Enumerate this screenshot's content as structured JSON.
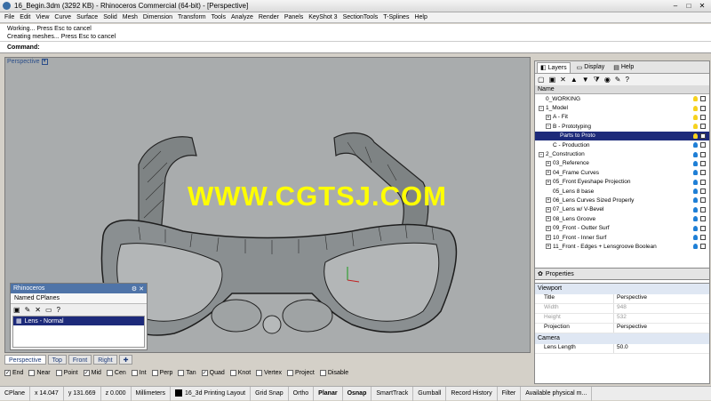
{
  "window": {
    "title": "16_Begin.3dm (3292 KB) - Rhinoceros Commercial (64-bit) - [Perspective]"
  },
  "menu": [
    "File",
    "Edit",
    "View",
    "Curve",
    "Surface",
    "Solid",
    "Mesh",
    "Dimension",
    "Transform",
    "Tools",
    "Analyze",
    "Render",
    "Panels",
    "KeyShot 3",
    "SectionTools",
    "T-Splines",
    "Help"
  ],
  "command_history": [
    "Working... Press Esc to cancel",
    "Creating meshes... Press Esc to cancel"
  ],
  "command_prompt": "Command:",
  "viewport": {
    "label": "Perspective"
  },
  "watermark": "WWW.CGTSJ.COM",
  "cplanes_panel": {
    "title": "Rhinoceros",
    "tab": "Named CPlanes",
    "items": [
      "Lens - Normal"
    ]
  },
  "viewport_tabs": [
    "Perspective",
    "Top",
    "Front",
    "Right"
  ],
  "osnaps": [
    {
      "label": "End",
      "checked": true
    },
    {
      "label": "Near",
      "checked": false
    },
    {
      "label": "Point",
      "checked": false
    },
    {
      "label": "Mid",
      "checked": true
    },
    {
      "label": "Cen",
      "checked": false
    },
    {
      "label": "Int",
      "checked": false
    },
    {
      "label": "Perp",
      "checked": false
    },
    {
      "label": "Tan",
      "checked": false
    },
    {
      "label": "Quad",
      "checked": true
    },
    {
      "label": "Knot",
      "checked": false
    },
    {
      "label": "Vertex",
      "checked": false
    },
    {
      "label": "Project",
      "checked": false
    },
    {
      "label": "Disable",
      "checked": false
    }
  ],
  "status": {
    "cplane": "CPlane",
    "x": "x 14.047",
    "y": "y 131.669",
    "z": "z 0.000",
    "units": "Millimeters",
    "layer": "16_3d Printing Layout",
    "grid_snap": "Grid Snap",
    "ortho": "Ortho",
    "planar": "Planar",
    "osnap": "Osnap",
    "smarttrack": "SmartTrack",
    "gumball": "Gumball",
    "record_history": "Record History",
    "filter": "Filter",
    "memory": "Available physical m..."
  },
  "right_panel": {
    "tabs": [
      "Layers",
      "Display",
      "Help"
    ],
    "header": "Name",
    "layers": [
      {
        "name": "0_WORKING",
        "indent": 1,
        "expander": "",
        "selected": false,
        "bulb": "y"
      },
      {
        "name": "1_Model",
        "indent": 1,
        "expander": "-",
        "selected": false,
        "bulb": "y"
      },
      {
        "name": "A - Fit",
        "indent": 2,
        "expander": "+",
        "selected": false,
        "bulb": "y"
      },
      {
        "name": "B - Prototyping",
        "indent": 2,
        "expander": "-",
        "selected": false,
        "bulb": "y"
      },
      {
        "name": "Parts to Proto",
        "indent": 3,
        "expander": "",
        "selected": true,
        "bulb": "y"
      },
      {
        "name": "C - Production",
        "indent": 2,
        "expander": "",
        "selected": false,
        "bulb": "b"
      },
      {
        "name": "2_Construction",
        "indent": 1,
        "expander": "-",
        "selected": false,
        "bulb": "b"
      },
      {
        "name": "03_Reference",
        "indent": 2,
        "expander": "+",
        "selected": false,
        "bulb": "b"
      },
      {
        "name": "04_Frame Curves",
        "indent": 2,
        "expander": "+",
        "selected": false,
        "bulb": "b"
      },
      {
        "name": "05_Front Eyeshape Projection",
        "indent": 2,
        "expander": "+",
        "selected": false,
        "bulb": "b"
      },
      {
        "name": "05_Lens 8 base",
        "indent": 2,
        "expander": "",
        "selected": false,
        "bulb": "b"
      },
      {
        "name": "06_Lens Curves Sized Properly",
        "indent": 2,
        "expander": "+",
        "selected": false,
        "bulb": "b"
      },
      {
        "name": "07_Lens w/ V-Bevel",
        "indent": 2,
        "expander": "+",
        "selected": false,
        "bulb": "b"
      },
      {
        "name": "08_Lens Groove",
        "indent": 2,
        "expander": "+",
        "selected": false,
        "bulb": "b"
      },
      {
        "name": "09_Front - Outter Surf",
        "indent": 2,
        "expander": "+",
        "selected": false,
        "bulb": "b"
      },
      {
        "name": "10_Front - Inner Surf",
        "indent": 2,
        "expander": "+",
        "selected": false,
        "bulb": "b"
      },
      {
        "name": "11_Front - Edges + Lensgroove Boolean",
        "indent": 2,
        "expander": "+",
        "selected": false,
        "bulb": "b"
      }
    ]
  },
  "properties": {
    "title": "Properties",
    "section_viewport": "Viewport",
    "rows": [
      {
        "k": "Title",
        "v": "Perspective",
        "disabled": false
      },
      {
        "k": "Width",
        "v": "948",
        "disabled": true
      },
      {
        "k": "Height",
        "v": "532",
        "disabled": true
      },
      {
        "k": "Projection",
        "v": "Perspective",
        "disabled": false
      }
    ],
    "section_camera": "Camera",
    "camera_rows": [
      {
        "k": "Lens Length",
        "v": "50.0",
        "disabled": false
      }
    ]
  },
  "colors": {
    "selection": "#1d2a7a",
    "watermark": "#ffff00",
    "viewport_bg": "#a9acad"
  }
}
